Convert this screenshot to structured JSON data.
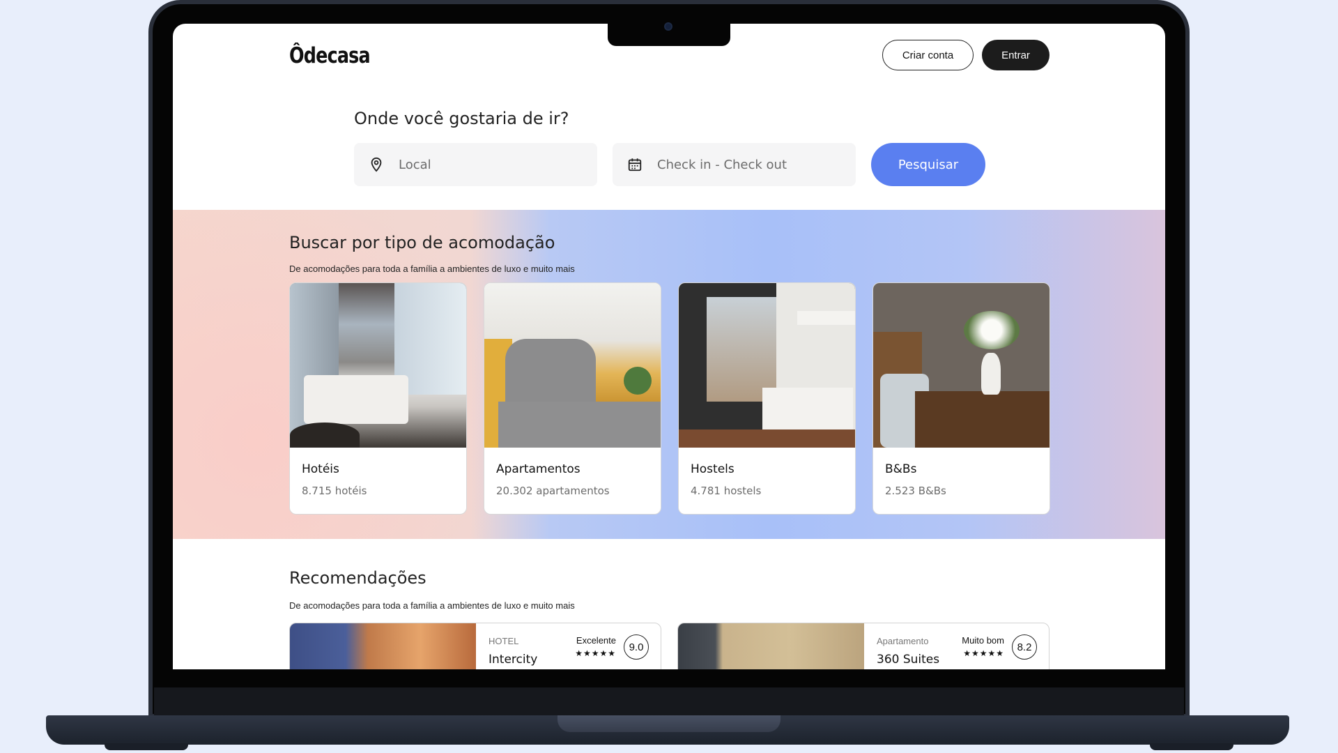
{
  "header": {
    "logo": "Ôdecasa",
    "create_account": "Criar conta",
    "login": "Entrar"
  },
  "search": {
    "title": "Onde você gostaria de ir?",
    "location_placeholder": "Local",
    "dates_placeholder": "Check in - Check out",
    "submit": "Pesquisar"
  },
  "types": {
    "title": "Buscar por tipo de acomodação",
    "subtitle": "De acomodações para toda a família a ambientes de luxo e muito mais",
    "cards": [
      {
        "name": "Hotéis",
        "count": "8.715 hotéis"
      },
      {
        "name": "Apartamentos",
        "count": "20.302 apartamentos"
      },
      {
        "name": "Hostels",
        "count": "4.781 hostels"
      },
      {
        "name": "B&Bs",
        "count": "2.523 B&Bs"
      }
    ]
  },
  "recommendations": {
    "title": "Recomendações",
    "subtitle": "De acomodações para toda a família a ambientes de luxo e muito mais",
    "items": [
      {
        "kind": "HOTEL",
        "name": "Intercity",
        "label": "Excelente",
        "stars": "★★★★★",
        "score": "9.0"
      },
      {
        "kind": "Apartamento",
        "name": "360 Suites",
        "label": "Muito bom",
        "stars": "★★★★★",
        "score": "8.2"
      }
    ]
  },
  "colors": {
    "accent": "#5a7ff0",
    "dark_button": "#1c1c1c"
  }
}
